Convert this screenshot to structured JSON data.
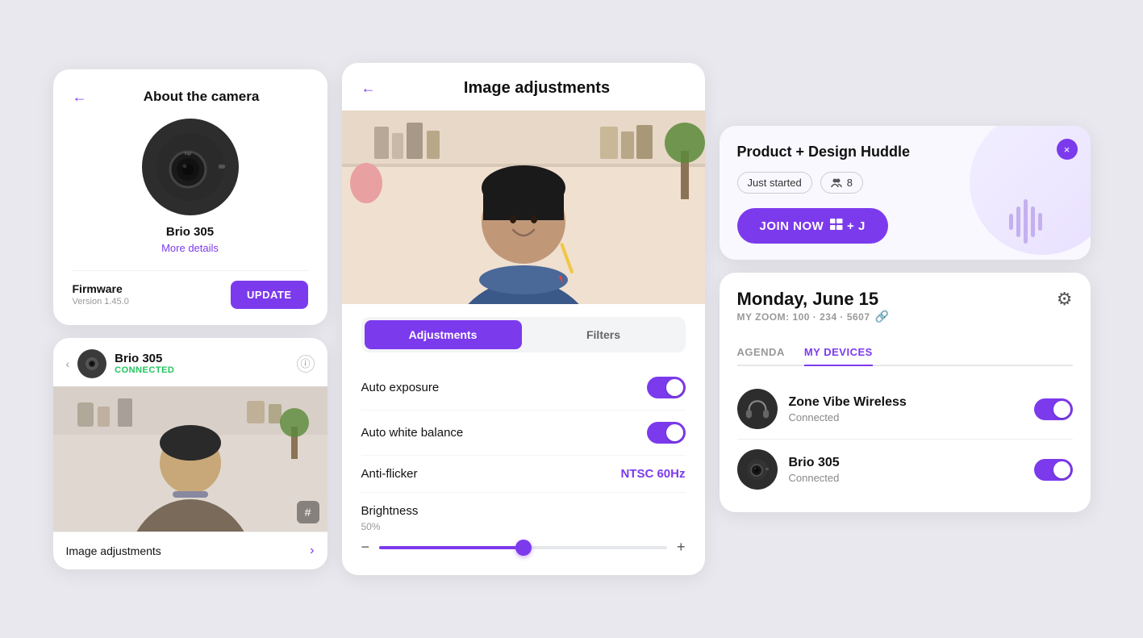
{
  "left": {
    "about_card": {
      "back_label": "←",
      "title": "About the camera",
      "device_name": "Brio 305",
      "more_details": "More details",
      "firmware_label": "Firmware",
      "firmware_version": "Version 1.45.0",
      "update_btn": "UPDATE"
    },
    "connected_card": {
      "nav_back": "‹",
      "device_name": "Brio 305",
      "status": "CONNECTED",
      "hash_symbol": "#",
      "image_adj_label": "Image adjustments",
      "chevron": "›"
    }
  },
  "middle": {
    "header": {
      "back_label": "←",
      "title": "Image adjustments"
    },
    "tabs": [
      {
        "label": "Adjustments",
        "active": true
      },
      {
        "label": "Filters",
        "active": false
      }
    ],
    "settings": [
      {
        "label": "Auto exposure",
        "type": "toggle",
        "value": true
      },
      {
        "label": "Auto white balance",
        "type": "toggle",
        "value": true
      },
      {
        "label": "Anti-flicker",
        "type": "select",
        "value": "NTSC 60Hz"
      }
    ],
    "brightness": {
      "label": "Brightness",
      "value": 50,
      "pct": "50%",
      "minus": "−",
      "plus": "+"
    }
  },
  "right": {
    "meeting_card": {
      "title": "Product + Design Huddle",
      "status_badge": "Just started",
      "participants": "8",
      "join_btn": "JOIN NOW",
      "shortcut": "⊞ + J",
      "close": "×"
    },
    "calendar_card": {
      "date": "Monday, June 15",
      "zoom_label": "MY ZOOM: 100 · 234 · 5607",
      "link_icon": "⛓",
      "tabs": [
        {
          "label": "AGENDA",
          "active": false
        },
        {
          "label": "MY DEVICES",
          "active": true
        }
      ],
      "devices": [
        {
          "name": "Zone Vibe Wireless",
          "status": "Connected",
          "toggle": true,
          "icon_type": "headphones"
        },
        {
          "name": "Brio 305",
          "status": "Connected",
          "toggle": true,
          "icon_type": "camera"
        }
      ]
    }
  }
}
